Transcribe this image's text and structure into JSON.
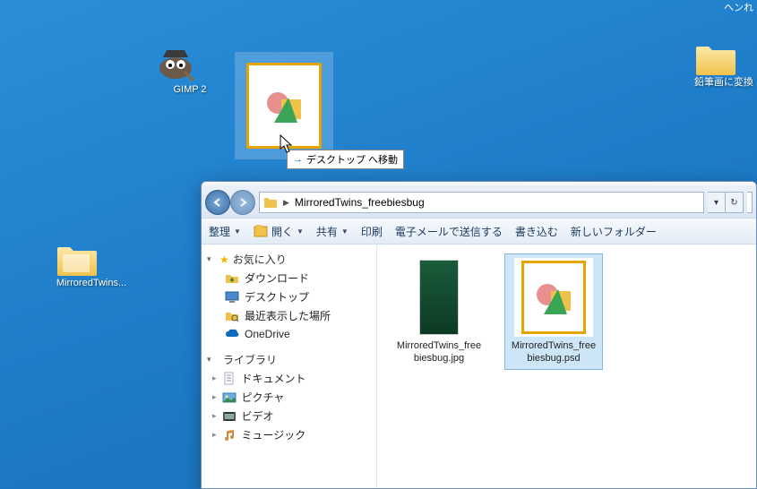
{
  "desktop": {
    "gimp": {
      "label": "GIMP 2"
    },
    "folder1": {
      "label": "MirroredTwins..."
    },
    "folder2": {
      "label": "鉛筆画に変換"
    },
    "partial_top": "ヘンれ"
  },
  "drag": {
    "tooltip": "デスクトップ へ移動"
  },
  "explorer": {
    "address_path": "MirroredTwins_freebiesbug",
    "toolbar": {
      "organize": "整理",
      "open": "開く",
      "share": "共有",
      "print": "印刷",
      "email": "電子メールで送信する",
      "burn": "書き込む",
      "new_folder": "新しいフォルダー"
    },
    "sidebar": {
      "favorites": {
        "label": "お気に入り",
        "items": [
          "ダウンロード",
          "デスクトップ",
          "最近表示した場所",
          "OneDrive"
        ]
      },
      "libraries": {
        "label": "ライブラリ",
        "items": [
          "ドキュメント",
          "ピクチャ",
          "ビデオ",
          "ミュージック"
        ]
      }
    },
    "files": {
      "jpg": "MirroredTwins_freebiesbug.jpg",
      "psd": "MirroredTwins_freebiesbug.psd"
    }
  }
}
